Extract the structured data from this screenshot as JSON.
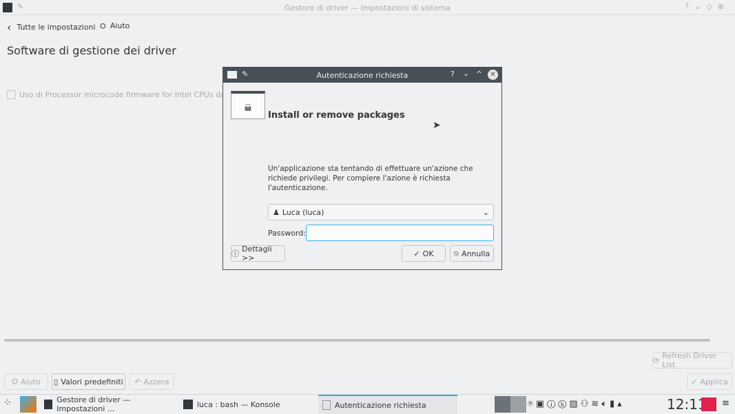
{
  "window": {
    "title": "Gestore di driver — Impostazioni di sistema"
  },
  "header": {
    "back_label": "Tutte le impostazioni",
    "help_label": "Aiuto"
  },
  "page": {
    "title": "Software di gestione dei driver",
    "checkbox_label": "Uso di Processor microcode firmware for Intel CPUs da intel-m"
  },
  "buttons": {
    "refresh": "Refresh Driver List",
    "help": "Aiuto",
    "defaults": "Valori predefiniti",
    "reset": "Azzera",
    "apply": "Applica"
  },
  "dialog": {
    "title": "Autenticazione richiesta",
    "heading": "Install or remove packages",
    "message": "Un'applicazione sta tentando di effettuare un'azione che richiede privilegi. Per compiere l'azione è richiesta l'autenticazione.",
    "user": "Luca (luca)",
    "password_label": "Password:",
    "password_value": "",
    "details": "Dettagli >>",
    "ok": "OK",
    "cancel": "Annulla"
  },
  "taskbar": {
    "tasks": [
      {
        "label": "Gestore di driver  — Impostazioni ..."
      },
      {
        "label": "luca : bash — Konsole"
      },
      {
        "label": "Autenticazione richiesta"
      }
    ],
    "clock": "12:11"
  },
  "colors": {
    "accent": "#3daee9",
    "titlebar": "#475057",
    "close": "#e5e5e5"
  }
}
